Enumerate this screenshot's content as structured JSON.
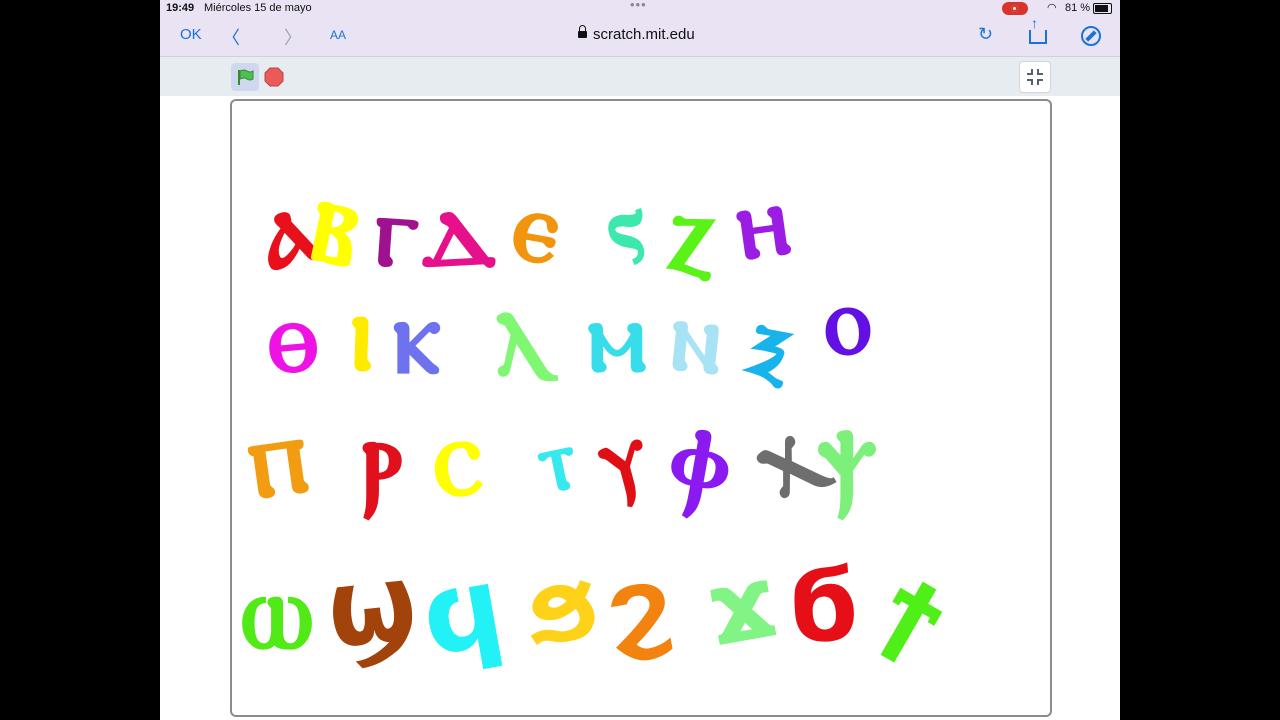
{
  "status": {
    "time": "19:49",
    "date": "Miércoles 15 de mayo",
    "battery": "81 %"
  },
  "browser": {
    "done_label": "OK",
    "text_size_label": "AA",
    "url": "scratch.mit.edu"
  },
  "stage": {
    "letters": [
      {
        "char": "ⲁ",
        "color": "#e8101b"
      },
      {
        "char": "ⲃ",
        "color": "#ffff00"
      },
      {
        "char": "ⲅ",
        "color": "#a0118f"
      },
      {
        "char": "ⲇ",
        "color": "#e5108a"
      },
      {
        "char": "ⲉ",
        "color": "#f0950d"
      },
      {
        "char": "ⲋ",
        "color": "#3de8ad"
      },
      {
        "char": "ⲍ",
        "color": "#5af217"
      },
      {
        "char": "ⲏ",
        "color": "#9b1ce3"
      },
      {
        "char": "ⲑ",
        "color": "#ef12e4"
      },
      {
        "char": "ⲓ",
        "color": "#ffeb00"
      },
      {
        "char": "ⲕ",
        "color": "#6f72ee"
      },
      {
        "char": "ⲗ",
        "color": "#7ff773"
      },
      {
        "char": "ⲙ",
        "color": "#37dde8"
      },
      {
        "char": "ⲛ",
        "color": "#a8e2f5"
      },
      {
        "char": "ⲝ",
        "color": "#19b3ec"
      },
      {
        "char": "ⲟ",
        "color": "#6210e3"
      },
      {
        "char": "ⲡ",
        "color": "#f29c12"
      },
      {
        "char": "ⲣ",
        "color": "#e0101d"
      },
      {
        "char": "ⲥ",
        "color": "#ffff00"
      },
      {
        "char": "ⲧ",
        "color": "#37e9ee"
      },
      {
        "char": "ⲩ",
        "color": "#e00f16"
      },
      {
        "char": "ⲫ",
        "color": "#8b1af0"
      },
      {
        "char": "ⲭ",
        "color": "#6e6e6e"
      },
      {
        "char": "ⲯ",
        "color": "#7cf07b"
      },
      {
        "char": "ⲱ",
        "color": "#52ea16"
      },
      {
        "char": "ϣ",
        "color": "#a3430c"
      },
      {
        "char": "ϥ",
        "color": "#22f2f5"
      },
      {
        "char": "ϧ",
        "color": "#ffd21a"
      },
      {
        "char": "ϩ",
        "color": "#f2830f"
      },
      {
        "char": "ϫ",
        "color": "#82f385"
      },
      {
        "char": "ϭ",
        "color": "#e70f17"
      },
      {
        "char": "ϯ",
        "color": "#4fef17"
      }
    ]
  }
}
